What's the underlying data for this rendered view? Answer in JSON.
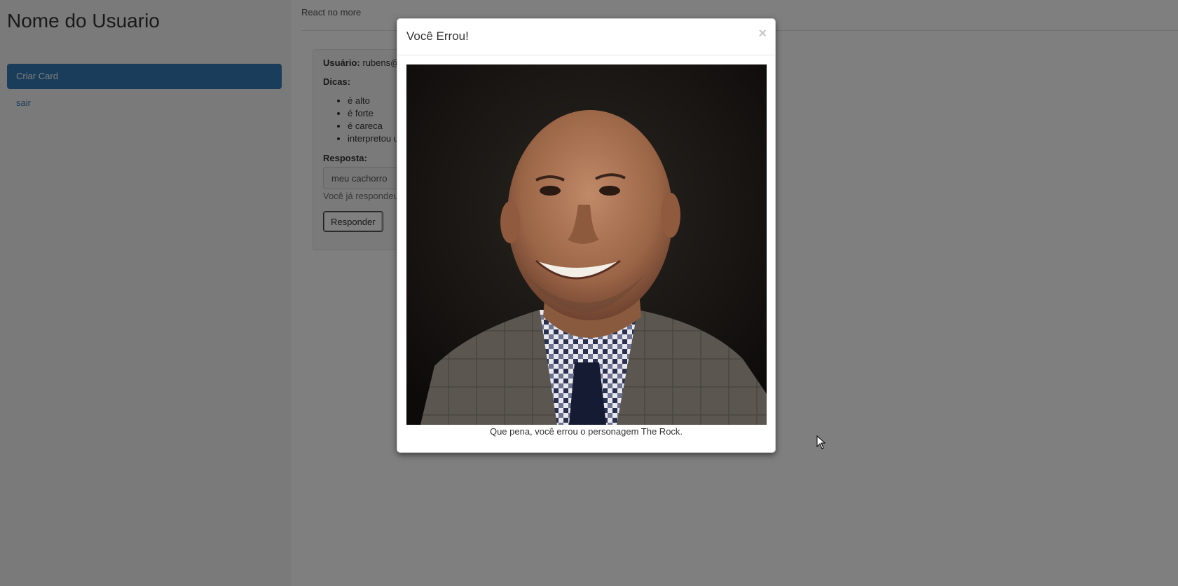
{
  "sidebar": {
    "title": "Nome do Usuario",
    "items": [
      {
        "label": "Criar Card"
      },
      {
        "label": "sair"
      }
    ]
  },
  "header": {
    "brand": "React no more"
  },
  "card": {
    "user_label": "Usuário:",
    "user_value": "rubens@",
    "hints_label": "Dicas:",
    "hints": [
      "é alto",
      "é forte",
      "é careca",
      "interpretou u"
    ],
    "answer_label": "Resposta:",
    "answer_value": "meu cachorro",
    "help_text": "Você já respondeu",
    "submit_label": "Responder"
  },
  "modal": {
    "title": "Você Errou!",
    "close_symbol": "×",
    "caption": "Que pena, você errou o personagem The Rock."
  },
  "colors": {
    "primary": "#337ab7",
    "backdrop": "rgba(0,0,0,0.5)"
  }
}
